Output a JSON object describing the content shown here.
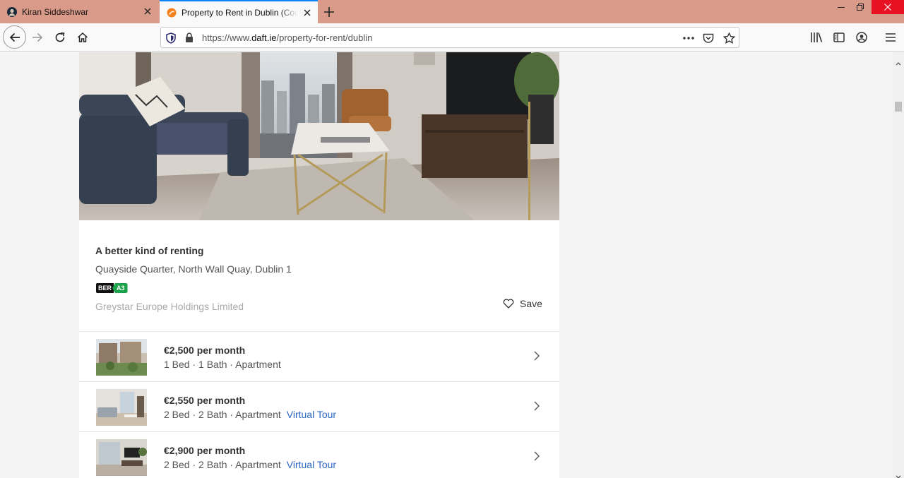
{
  "browser": {
    "tabs": [
      {
        "title": "Kiran Siddeshwar",
        "active": false
      },
      {
        "title": "Property to Rent in Dublin (County)",
        "active": true
      }
    ],
    "url_prefix": "https://www.",
    "url_domain": "daft.ie",
    "url_path": "/property-for-rent/dublin",
    "accent_color": "#0a84ff",
    "tabstrip_color": "#d99a89"
  },
  "listing": {
    "title": "A better kind of renting",
    "address": "Quayside Quarter, North Wall Quay, Dublin 1",
    "ber_label": "BER",
    "ber_grade": "A3",
    "agent": "Greystar Europe Holdings Limited",
    "save_label": "Save",
    "units": [
      {
        "price": "€2,500 per month",
        "details": "1 Bed · 1 Bath · Apartment",
        "virtual_tour": ""
      },
      {
        "price": "€2,550 per month",
        "details": "2 Bed · 2 Bath · Apartment",
        "virtual_tour": "Virtual Tour"
      },
      {
        "price": "€2,900 per month",
        "details": "2 Bed · 2 Bath · Apartment",
        "virtual_tour": "Virtual Tour"
      }
    ]
  }
}
